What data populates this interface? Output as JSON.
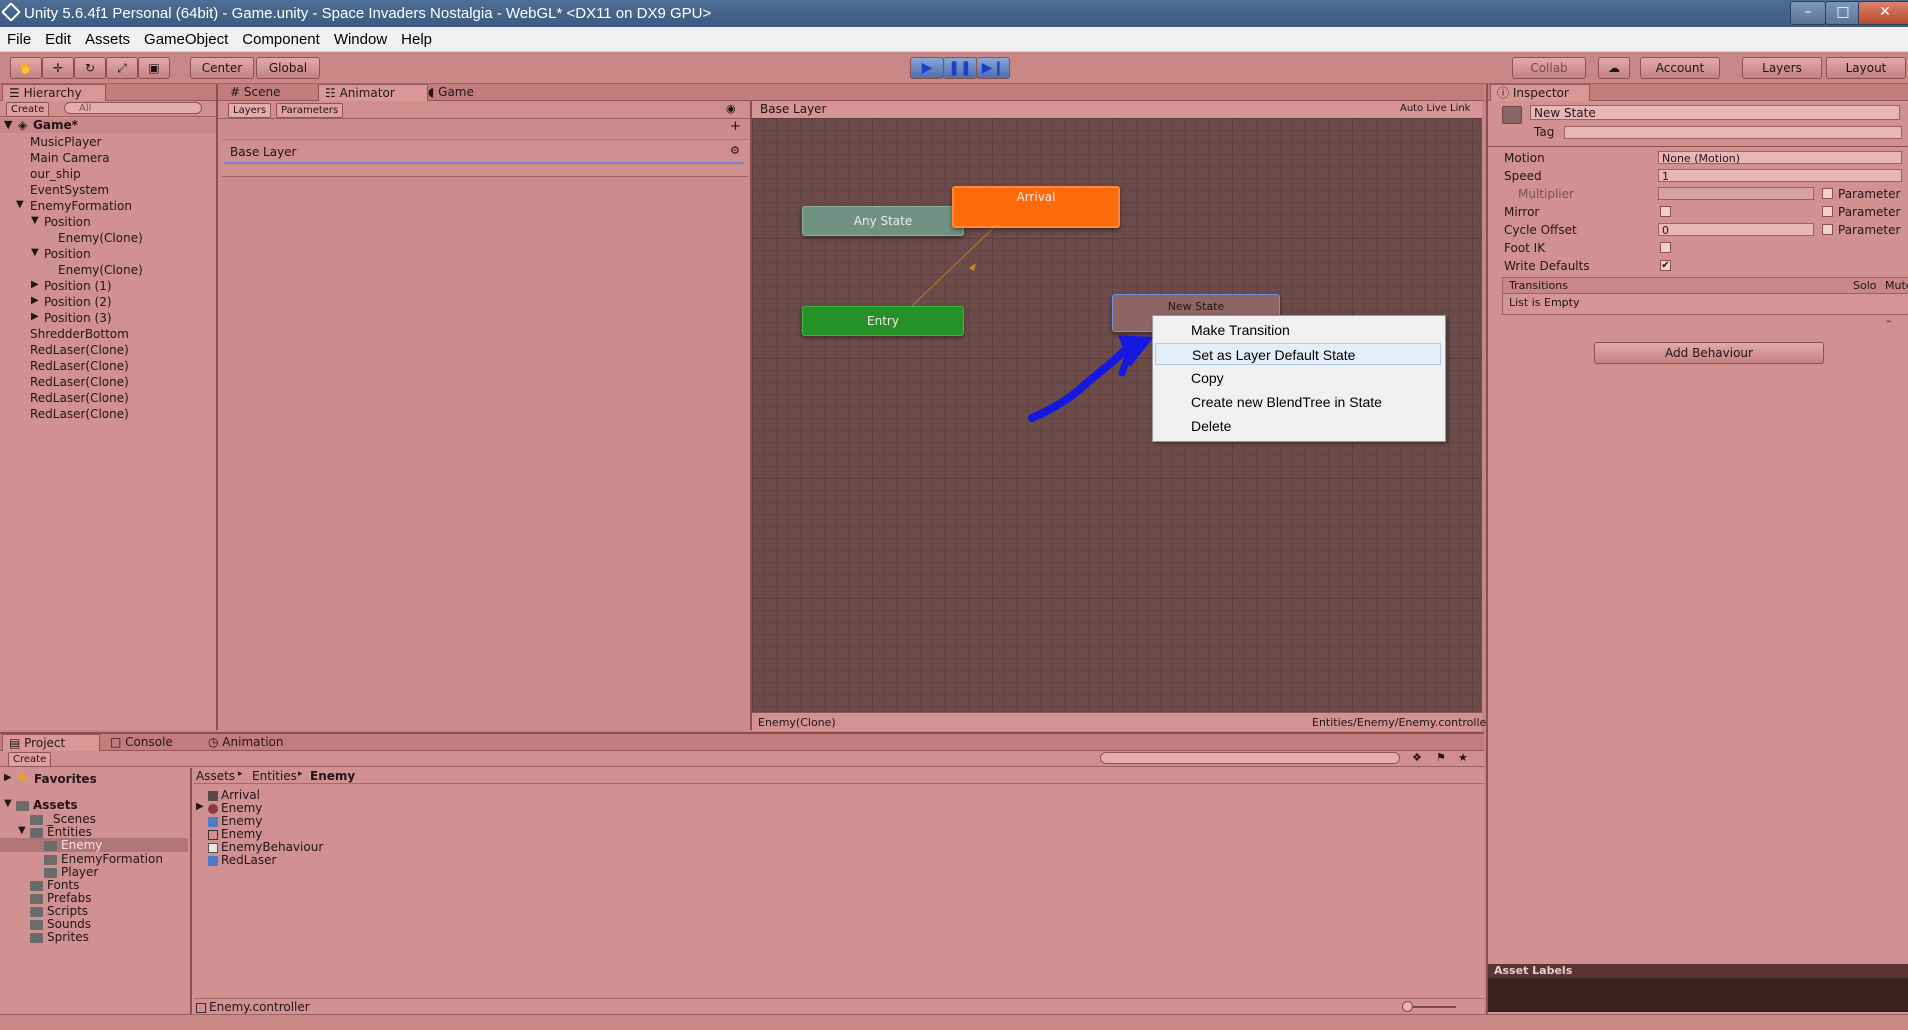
{
  "window": {
    "title": "Unity 5.6.4f1 Personal (64bit) - Game.unity - Space Invaders Nostalgia - WebGL* <DX11 on DX9 GPU>"
  },
  "menu": [
    "File",
    "Edit",
    "Assets",
    "GameObject",
    "Component",
    "Window",
    "Help"
  ],
  "toolbar": {
    "pivot_label": "Center",
    "space_label": "Global",
    "collab_label": "Collab",
    "account_label": "Account",
    "layers_label": "Layers",
    "layout_label": "Layout"
  },
  "hierarchy": {
    "tab": "Hierarchy",
    "create_label": "Create",
    "search_placeholder": "All",
    "scene": "Game*",
    "items": [
      "MusicPlayer",
      "Main Camera",
      "our_ship",
      "EventSystem",
      "EnemyFormation",
      "Position",
      "Enemy(Clone)",
      "Position",
      "Enemy(Clone)",
      "Position (1)",
      "Position (2)",
      "Position (3)",
      "ShredderBottom",
      "RedLaser(Clone)",
      "RedLaser(Clone)",
      "RedLaser(Clone)",
      "RedLaser(Clone)",
      "RedLaser(Clone)"
    ]
  },
  "center_tabs": [
    "Scene",
    "Animator",
    "Game"
  ],
  "animator": {
    "layers_tab": "Layers",
    "parameters_tab": "Parameters",
    "layer_name": "Base Layer",
    "breadcrumb": "Base Layer",
    "auto_live_link": "Auto Live Link",
    "states": {
      "any_state": "Any State",
      "arrival": "Arrival",
      "entry": "Entry",
      "new_state": "New State"
    },
    "status_left": "Enemy(Clone)",
    "status_right": "Entities/Enemy/Enemy.controller"
  },
  "context_menu": {
    "items": [
      "Make Transition",
      "Set as Layer Default State",
      "Copy",
      "Create new BlendTree in State",
      "Delete"
    ],
    "highlighted": "Set as Layer Default State"
  },
  "inspector": {
    "tab": "Inspector",
    "name": "New State",
    "tag_label": "Tag",
    "motion_label": "Motion",
    "motion_value": "None (Motion)",
    "speed_label": "Speed",
    "speed_value": "1",
    "multiplier_label": "Multiplier",
    "parameter_label": "Parameter",
    "mirror_label": "Mirror",
    "cycle_offset_label": "Cycle Offset",
    "cycle_offset_value": "0",
    "foot_ik_label": "Foot IK",
    "write_defaults_label": "Write Defaults",
    "write_defaults_checked": true,
    "transitions_label": "Transitions",
    "solo_label": "Solo",
    "mute_label": "Mute",
    "list_empty": "List is Empty",
    "add_behaviour": "Add Behaviour",
    "asset_labels": "Asset Labels"
  },
  "bottom_tabs": [
    "Project",
    "Console",
    "Animation"
  ],
  "project": {
    "create_label": "Create",
    "favorites": "Favorites",
    "assets": "Assets",
    "folders": [
      "_Scenes",
      "Entities",
      "Enemy",
      "EnemyFormation",
      "Player",
      "Fonts",
      "Prefabs",
      "Scripts",
      "Sounds",
      "Sprites"
    ],
    "breadcrumb": [
      "Assets",
      "Entities",
      "Enemy"
    ],
    "files": [
      "Arrival",
      "Enemy",
      "Enemy",
      "Enemy",
      "EnemyBehaviour",
      "RedLaser"
    ],
    "selected_file": "Enemy.controller"
  },
  "colors": {
    "titlebar": "#3d5a80",
    "theme_tint": "#c88584",
    "graph_bg": "#6c4c4b",
    "arrival_node": "#ff6a0a",
    "entry_node": "#259227",
    "any_state_node": "#6f9284",
    "annotation_arrow": "#1518e0"
  }
}
